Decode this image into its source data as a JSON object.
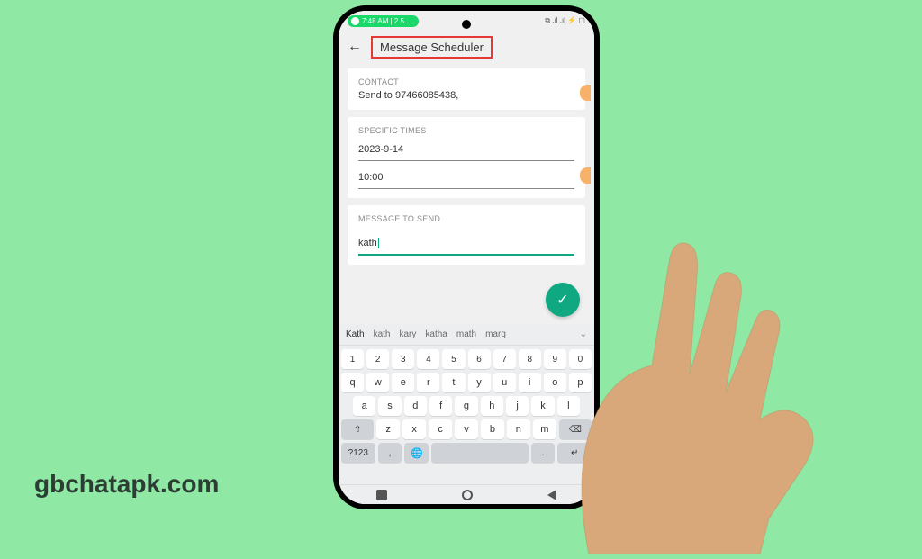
{
  "watermark": "gbchatapk.com",
  "status": {
    "time_text": "7:48 AM | 2.5…",
    "icons_text": "⧉ .ıl .ıl ⚡ ▢"
  },
  "header": {
    "title": "Message Scheduler"
  },
  "contact": {
    "label": "CONTACT",
    "value": "Send to 97466085438,"
  },
  "times": {
    "label": "SPECIFIC TIMES",
    "date": "2023-9-14",
    "time": "10:00"
  },
  "message": {
    "label": "MESSAGE TO SEND",
    "value": "kath"
  },
  "suggestions": [
    "Kath",
    "kath",
    "kary",
    "katha",
    "math",
    "marg"
  ],
  "keyboard": {
    "row1": [
      "1",
      "2",
      "3",
      "4",
      "5",
      "6",
      "7",
      "8",
      "9",
      "0"
    ],
    "row2": [
      "q",
      "w",
      "e",
      "r",
      "t",
      "y",
      "u",
      "i",
      "o",
      "p"
    ],
    "row3": [
      "a",
      "s",
      "d",
      "f",
      "g",
      "h",
      "j",
      "k",
      "l"
    ],
    "row4": [
      "z",
      "x",
      "c",
      "v",
      "b",
      "n",
      "m"
    ],
    "shift": "⇧",
    "backspace": "⌫",
    "sym": "?123",
    "comma": ",",
    "globe": "🌐",
    "period": ".",
    "enter": "↵"
  }
}
